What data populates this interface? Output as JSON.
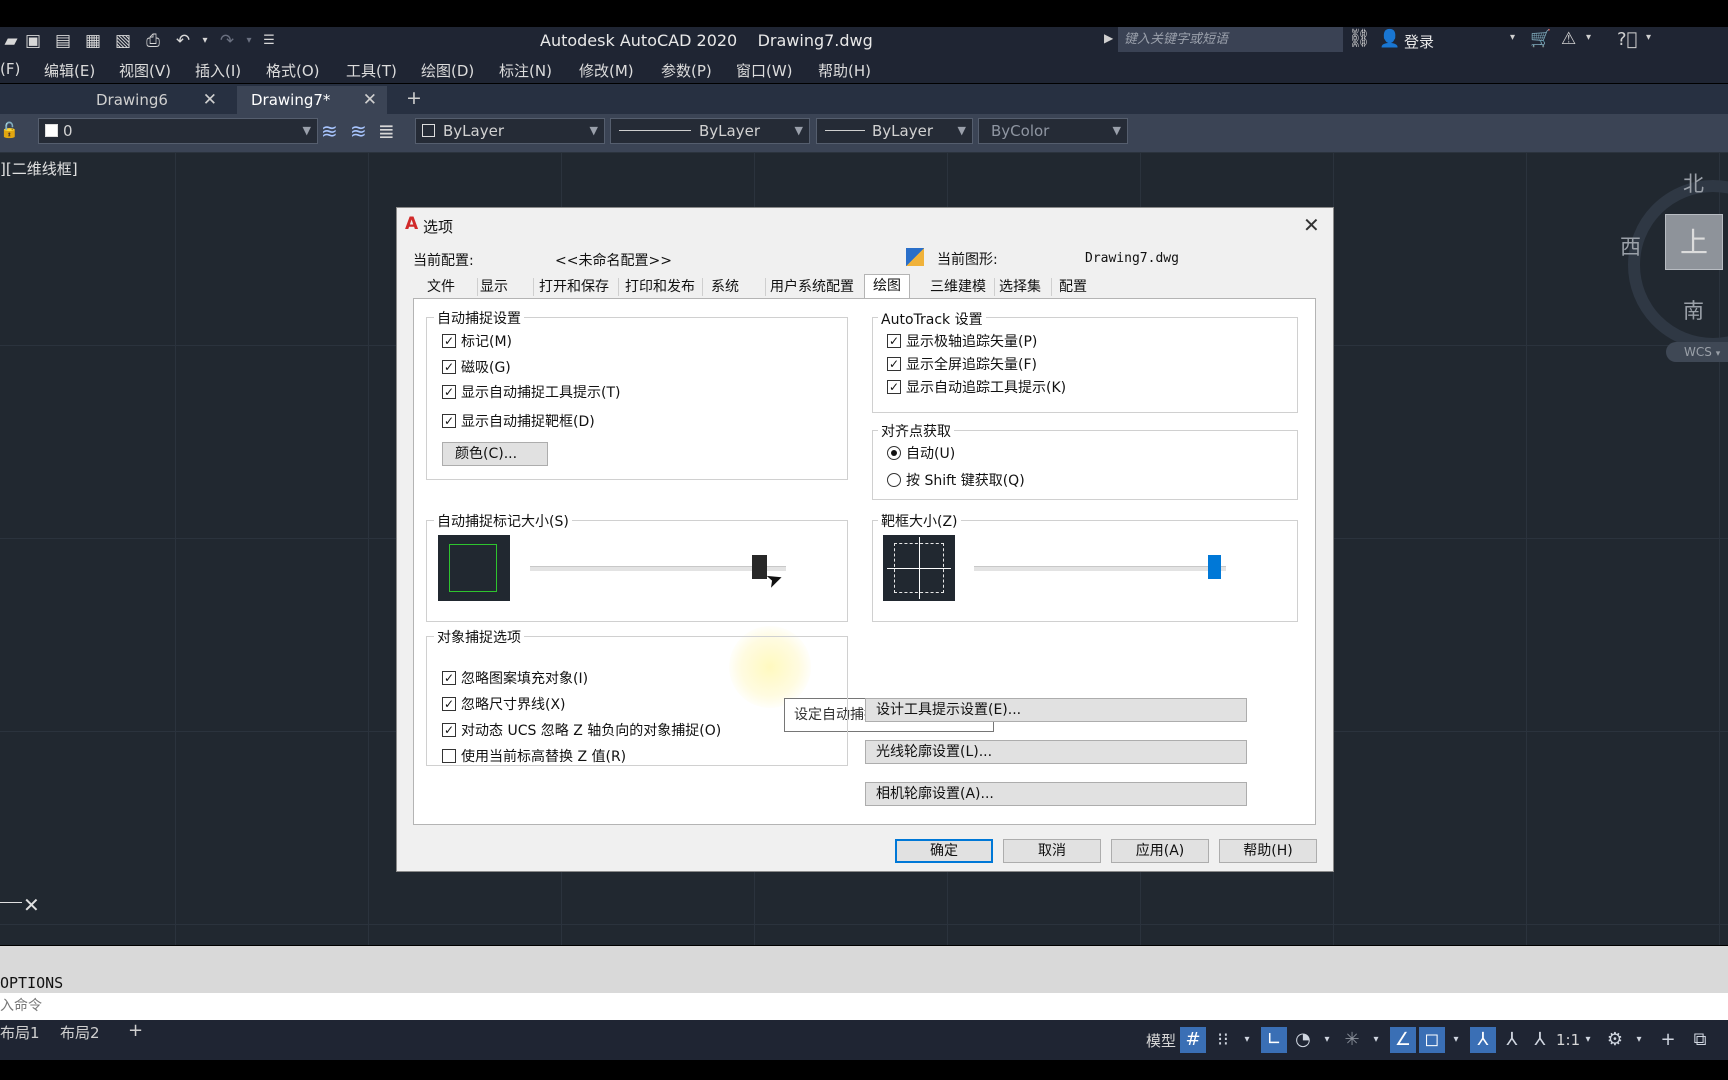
{
  "app": {
    "title": "Autodesk AutoCAD 2020",
    "file": "Drawing7.dwg",
    "search_placeholder": "键入关键字或短语",
    "login": "登录"
  },
  "menu": [
    "(F)",
    "编辑(E)",
    "视图(V)",
    "插入(I)",
    "格式(O)",
    "工具(T)",
    "绘图(D)",
    "标注(N)",
    "修改(M)",
    "参数(P)",
    "窗口(W)",
    "帮助(H)"
  ],
  "doc_tabs": [
    {
      "label": "Drawing6",
      "active": false
    },
    {
      "label": "Drawing7*",
      "active": true
    }
  ],
  "properties": {
    "layer": "0",
    "color": "ByLayer",
    "linetype": "ByLayer",
    "lineweight": "ByLayer",
    "plotstyle": "ByColor"
  },
  "viewport_label": "][二维线框]",
  "viewcube": {
    "north": "北",
    "south": "南",
    "west": "西",
    "top": "上",
    "wcs": "WCS"
  },
  "command": {
    "history": "OPTIONS",
    "input_placeholder": "入命令"
  },
  "layout_tabs": [
    "布局1",
    "布局2"
  ],
  "status": {
    "model": "模型",
    "scale": "1:1"
  },
  "dialog": {
    "title": "选项",
    "current_profile_label": "当前配置:",
    "current_profile_value": "<<未命名配置>>",
    "current_drawing_label": "当前图形:",
    "current_drawing_value": "Drawing7.dwg",
    "tabs": [
      "文件",
      "显示",
      "打开和保存",
      "打印和发布",
      "系统",
      "用户系统配置",
      "绘图",
      "三维建模",
      "选择集",
      "配置"
    ],
    "active_tab": "绘图",
    "autosnap": {
      "title": "自动捕捉设置",
      "items": [
        {
          "label": "标记(M)",
          "checked": true
        },
        {
          "label": "磁吸(G)",
          "checked": true
        },
        {
          "label": "显示自动捕捉工具提示(T)",
          "checked": true
        },
        {
          "label": "显示自动捕捉靶框(D)",
          "checked": true
        }
      ],
      "color_button": "颜色(C)..."
    },
    "autotrack": {
      "title": "AutoTrack 设置",
      "items": [
        {
          "label": "显示极轴追踪矢量(P)",
          "checked": true
        },
        {
          "label": "显示全屏追踪矢量(F)",
          "checked": true
        },
        {
          "label": "显示自动追踪工具提示(K)",
          "checked": true
        }
      ]
    },
    "alignment": {
      "title": "对齐点获取",
      "options": [
        {
          "label": "自动(U)",
          "selected": true
        },
        {
          "label": "按 Shift 键获取(Q)",
          "selected": false
        }
      ]
    },
    "marker_size": {
      "title": "自动捕捉标记大小(S)",
      "level": 0.92
    },
    "aperture_size": {
      "title": "靶框大小(Z)",
      "level": 0.98
    },
    "tooltip": "设定自动捕捉标记的显示尺寸。",
    "osnap": {
      "title": "对象捕捉选项",
      "items": [
        {
          "label": "忽略图案填充对象(I)",
          "checked": true
        },
        {
          "label": "忽略尺寸界线(X)",
          "checked": true
        },
        {
          "label": "对动态 UCS 忽略 Z 轴负向的对象捕捉(O)",
          "checked": true
        },
        {
          "label": "使用当前标高替换 Z 值(R)",
          "checked": false
        }
      ]
    },
    "buttons_right": [
      "设计工具提示设置(E)...",
      "光线轮廓设置(L)...",
      "相机轮廓设置(A)..."
    ],
    "footer": {
      "ok": "确定",
      "cancel": "取消",
      "apply": "应用(A)",
      "help": "帮助(H)"
    },
    "colors": {
      "accent": "#0078d7",
      "marker_green": "#2ec42e"
    }
  }
}
